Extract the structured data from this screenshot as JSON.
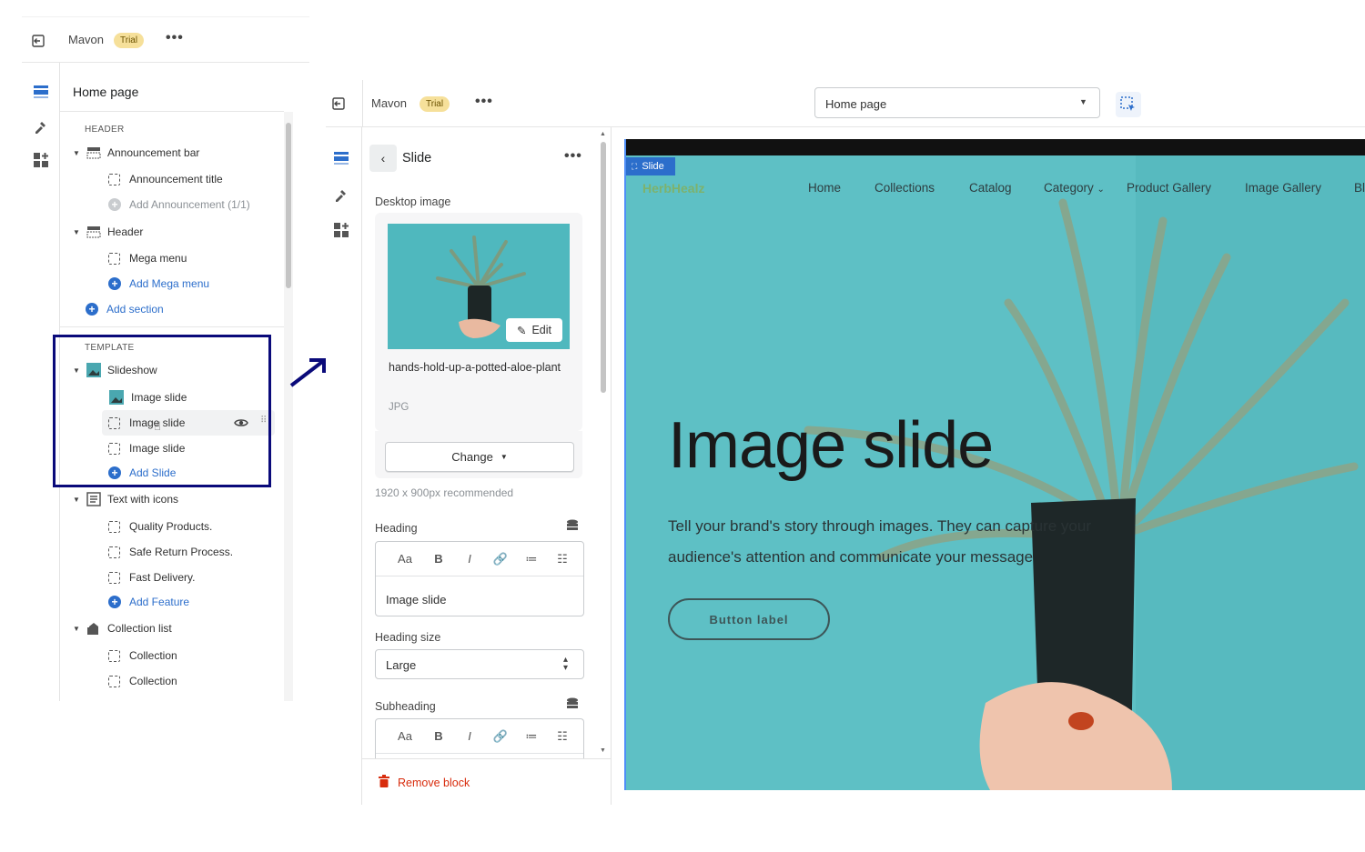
{
  "left_panel": {
    "store_name": "Mavon",
    "trial_badge": "Trial",
    "more": "•••",
    "page_title": "Home page",
    "header_label": "HEADER",
    "template_label": "TEMPLATE",
    "tree": {
      "announcement_bar": "Announcement bar",
      "announcement_title": "Announcement title",
      "add_announcement": "Add Announcement (1/1)",
      "header": "Header",
      "mega_menu": "Mega menu",
      "add_mega_menu": "Add Mega menu",
      "add_section": "Add section",
      "slideshow": "Slideshow",
      "image_slide_1": "Image slide",
      "image_slide_2": "Image slide",
      "image_slide_3": "Image slide",
      "add_slide": "Add Slide",
      "text_with_icons": "Text with icons",
      "quality_products": "Quality Products.",
      "safe_return": "Safe Return Process.",
      "fast_delivery": "Fast Delivery.",
      "add_feature": "Add Feature",
      "collection_list": "Collection list",
      "collection_1": "Collection",
      "collection_2": "Collection"
    }
  },
  "top_bar": {
    "store_name": "Mavon",
    "trial_badge": "Trial",
    "more": "•••",
    "page_select": "Home page"
  },
  "settings": {
    "title": "Slide",
    "more": "•••",
    "desktop_image_label": "Desktop image",
    "edit_label": "Edit",
    "file_name": "hands-hold-up-a-potted-aloe-plant",
    "file_type": "JPG",
    "change_label": "Change",
    "recommendation": "1920 x 900px recommended",
    "heading_label": "Heading",
    "heading_value": "Image slide",
    "heading_size_label": "Heading size",
    "heading_size_value": "Large",
    "subheading_label": "Subheading",
    "remove_block": "Remove block",
    "toolbar": [
      "Aa",
      "B",
      "I",
      "🔗",
      "≔",
      "☷"
    ]
  },
  "preview": {
    "slide_tag": "Slide",
    "logo": "HerbHealz",
    "nav": [
      "Home",
      "Collections",
      "Catalog",
      "Category",
      "Product Gallery",
      "Image Gallery",
      "Bl"
    ],
    "heading": "Image slide",
    "subheading_line1": "Tell your brand's story through images. They can capture your",
    "subheading_line2": "audience's attention and communicate your message",
    "button_label": "Button label"
  },
  "colors": {
    "accent_blue": "#2c6ecb",
    "highlight_box": "#0a0a7a",
    "trial_badge": "#f6e09a",
    "preview_bg": "#5cbfc4",
    "remove_red": "#d82c0d"
  }
}
